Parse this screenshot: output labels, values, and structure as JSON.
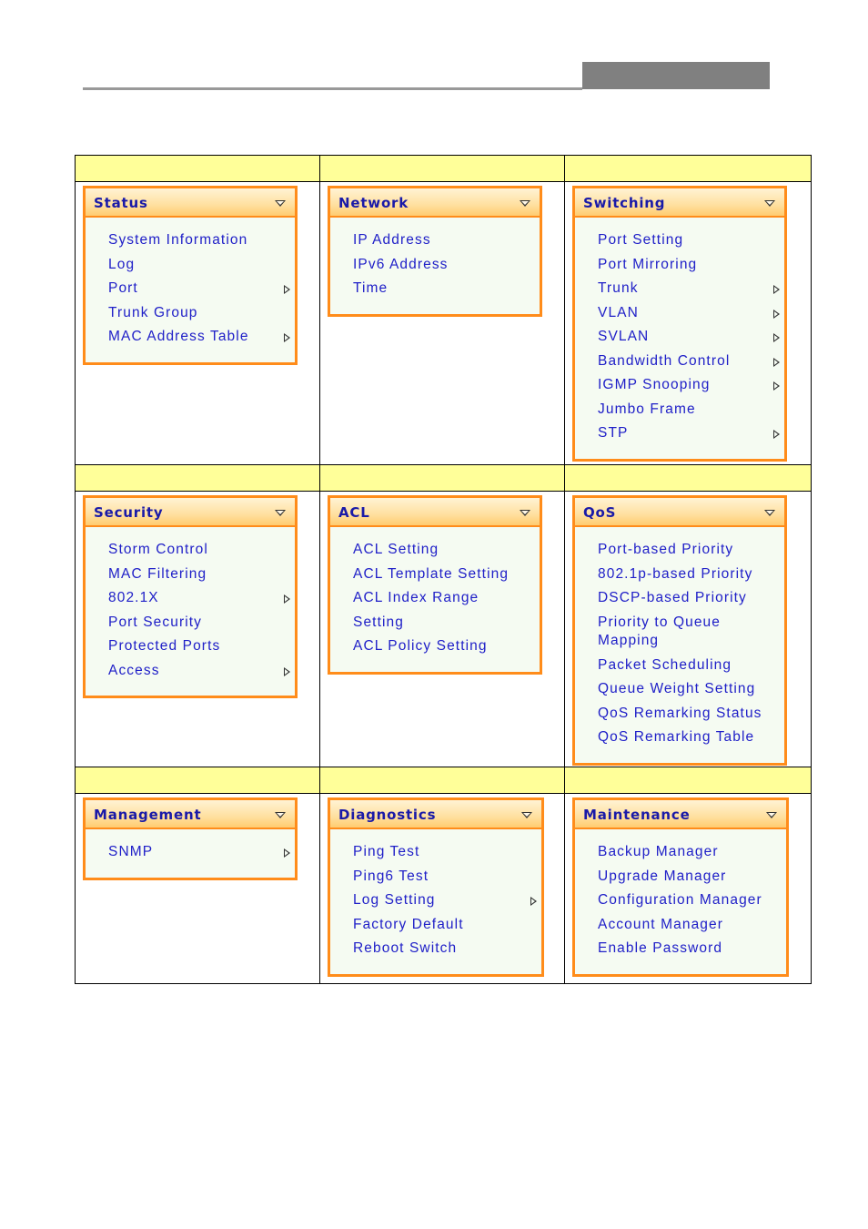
{
  "menus": [
    {
      "title": "Status",
      "items": [
        {
          "label": "System Information",
          "submenu": false
        },
        {
          "label": "Log",
          "submenu": false
        },
        {
          "label": "Port",
          "submenu": true
        },
        {
          "label": "Trunk Group",
          "submenu": false
        },
        {
          "label": "MAC Address Table",
          "submenu": true
        }
      ]
    },
    {
      "title": "Network",
      "items": [
        {
          "label": "IP Address",
          "submenu": false
        },
        {
          "label": "IPv6 Address",
          "submenu": false
        },
        {
          "label": "Time",
          "submenu": false
        }
      ]
    },
    {
      "title": "Switching",
      "items": [
        {
          "label": "Port Setting",
          "submenu": false
        },
        {
          "label": "Port Mirroring",
          "submenu": false
        },
        {
          "label": "Trunk",
          "submenu": true
        },
        {
          "label": "VLAN",
          "submenu": true
        },
        {
          "label": "SVLAN",
          "submenu": true
        },
        {
          "label": "Bandwidth Control",
          "submenu": true
        },
        {
          "label": "IGMP Snooping",
          "submenu": true
        },
        {
          "label": "Jumbo Frame",
          "submenu": false
        },
        {
          "label": "STP",
          "submenu": true
        }
      ]
    },
    {
      "title": "Security",
      "items": [
        {
          "label": "Storm Control",
          "submenu": false
        },
        {
          "label": "MAC Filtering",
          "submenu": false
        },
        {
          "label": "802.1X",
          "submenu": true
        },
        {
          "label": "Port Security",
          "submenu": false
        },
        {
          "label": "Protected Ports",
          "submenu": false
        },
        {
          "label": "Access",
          "submenu": true
        }
      ]
    },
    {
      "title": "ACL",
      "items": [
        {
          "label": "ACL Setting",
          "submenu": false
        },
        {
          "label": "ACL Template Setting",
          "submenu": false
        },
        {
          "label": "ACL Index Range Setting",
          "submenu": false
        },
        {
          "label": "ACL Policy Setting",
          "submenu": false
        }
      ]
    },
    {
      "title": "QoS",
      "items": [
        {
          "label": "Port-based Priority",
          "submenu": false
        },
        {
          "label": "802.1p-based Priority",
          "submenu": false
        },
        {
          "label": "DSCP-based Priority",
          "submenu": false
        },
        {
          "label": "Priority to Queue Mapping",
          "submenu": false
        },
        {
          "label": "Packet Scheduling",
          "submenu": false
        },
        {
          "label": "Queue Weight Setting",
          "submenu": false
        },
        {
          "label": "QoS Remarking Status",
          "submenu": false
        },
        {
          "label": "QoS Remarking Table",
          "submenu": false
        }
      ]
    },
    {
      "title": "Management",
      "items": [
        {
          "label": "SNMP",
          "submenu": true
        }
      ]
    },
    {
      "title": "Diagnostics",
      "items": [
        {
          "label": "Ping Test",
          "submenu": false
        },
        {
          "label": "Ping6 Test",
          "submenu": false
        },
        {
          "label": "Log Setting",
          "submenu": true
        },
        {
          "label": "Factory Default",
          "submenu": false
        },
        {
          "label": "Reboot Switch",
          "submenu": false
        }
      ]
    },
    {
      "title": "Maintenance",
      "items": [
        {
          "label": "Backup Manager",
          "submenu": false
        },
        {
          "label": "Upgrade Manager",
          "submenu": false
        },
        {
          "label": "Configuration Manager",
          "submenu": false
        },
        {
          "label": "Account Manager",
          "submenu": false
        },
        {
          "label": "Enable Password",
          "submenu": false
        }
      ]
    }
  ],
  "colors": {
    "header_row": "#ffff99",
    "menu_border": "#ff8c1a",
    "menu_text": "#2020c8",
    "menu_title": "#1a1aa8",
    "menu_body": "#f5fbf2",
    "header_block": "#808080",
    "header_rule": "#999999"
  }
}
